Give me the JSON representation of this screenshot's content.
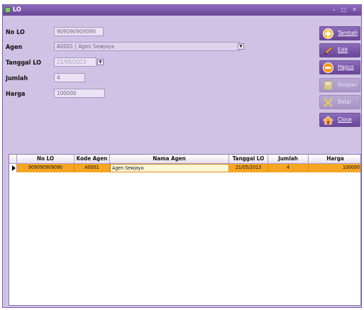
{
  "window": {
    "title": "LO"
  },
  "form": {
    "no_lo": {
      "label": "No LO",
      "value": "909090909090"
    },
    "agen": {
      "label": "Agen",
      "value": "A0001 | Agen Sewjaya"
    },
    "tanggal_lo": {
      "label": "Tanggal LO",
      "value": "21/05/2013"
    },
    "jumlah": {
      "label": "Jumlah",
      "value": "4"
    },
    "harga": {
      "label": "Harga",
      "value": "100000"
    }
  },
  "buttons": {
    "tambah": "Tambah",
    "edit": "Edit",
    "hapus": "Hapus",
    "simpan": "Simpan",
    "batal": "Batal",
    "close": "Close"
  },
  "table": {
    "columns": [
      "No LO",
      "Kode Agen",
      "Nama Agen",
      "Tanggal LO",
      "Jumlah",
      "Harga"
    ],
    "rows": [
      {
        "no_lo": "909090909090",
        "kode_agen": "A0001",
        "nama_agen": "Agen Sewjaya",
        "tanggal_lo": "21/05/2013",
        "jumlah": "4",
        "harga": "100000"
      }
    ]
  },
  "icons": {
    "tambah": "plus-circle-icon",
    "edit": "pencil-icon",
    "hapus": "minus-circle-icon",
    "simpan": "save-icon",
    "batal": "x-icon",
    "close": "home-icon"
  },
  "colors": {
    "window_bg": "#d0c2e4",
    "titlebar": "#7a55ac",
    "selected_row": "#f6a623"
  }
}
